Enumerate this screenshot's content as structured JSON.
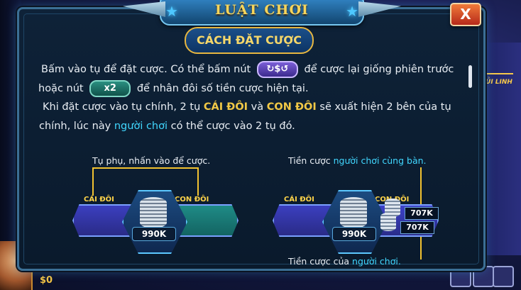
{
  "header": {
    "title": "LUẬT CHƠI",
    "close_label": "X"
  },
  "section_title": "CÁCH ĐẶT CƯỢC",
  "paragraph": {
    "l1_a": "Bấm vào tụ để đặt cược. Có thể bấm nút",
    "repeat_button": "↻$↺",
    "l1_b": "để cược lại giống phiên trước",
    "l2_a": "hoặc nút",
    "double_button": "x2",
    "l2_b": "để nhân đôi số tiền cược hiện tại.",
    "l3_a": "Khi đặt cược vào tụ chính, 2 tụ",
    "cai_doi": "CÁI ĐÔI",
    "va": "và",
    "con_doi": "CON ĐÔI",
    "l3_b": "sẽ xuất hiện 2 bên của tụ",
    "l4_a": "chính, lúc này",
    "nguoi_choi": "người chơi",
    "l4_b": "có thể cược vào 2 tụ đó."
  },
  "diagram_left": {
    "note": "Tụ phụ, nhấn vào để cược.",
    "label_left": "CÁI ĐÔI",
    "label_right": "CON ĐÔI",
    "amount": "990K"
  },
  "diagram_right": {
    "note_top_a": "Tiền cược",
    "note_top_b": "người chơi cùng bàn.",
    "label_left": "CÁI ĐÔI",
    "label_right": "CON ĐÔI",
    "amount": "990K",
    "tag1": "707K",
    "tag2": "707K",
    "note_bottom_a": "Tiền cược của",
    "note_bottom_b": "người chơi."
  },
  "side_badge": "ỦI LINH",
  "player_money": "$0",
  "colors": {
    "gold": "#f1c846",
    "cyan": "#41d7ff",
    "panel": "#0e2238"
  }
}
